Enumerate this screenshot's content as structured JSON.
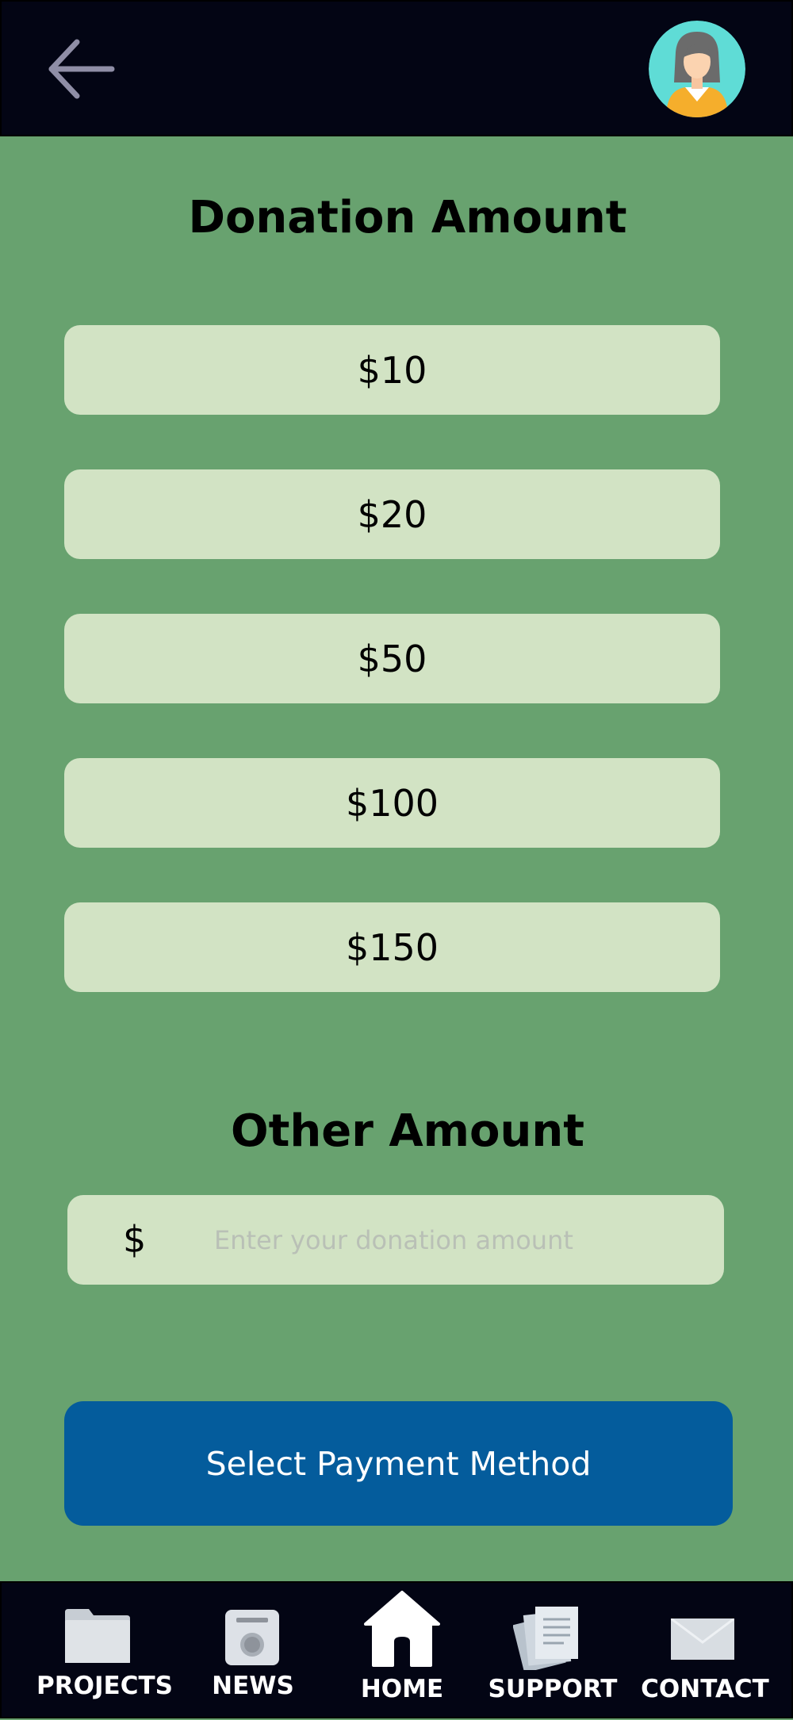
{
  "header": {
    "back_icon": "arrow-left-icon",
    "avatar_icon": "user-avatar-icon"
  },
  "donation": {
    "title": "Donation Amount",
    "amounts": [
      "$10",
      "$20",
      "$50",
      "$100",
      "$150"
    ]
  },
  "other": {
    "title": "Other Amount",
    "currency_symbol": "$",
    "placeholder": "Enter your donation amount",
    "value": ""
  },
  "payment_button": {
    "label": "Select Payment Method"
  },
  "nav": {
    "items": [
      {
        "label": "PROJECTS",
        "icon": "folder-icon"
      },
      {
        "label": "NEWS",
        "icon": "radio-icon"
      },
      {
        "label": "HOME",
        "icon": "home-icon"
      },
      {
        "label": "SUPPORT",
        "icon": "documents-icon"
      },
      {
        "label": "CONTACT",
        "icon": "envelope-icon"
      }
    ]
  },
  "colors": {
    "background": "#68a26f",
    "bars": "#030514",
    "amount_button": "#d2e3c4",
    "primary_button": "#045c9c"
  }
}
